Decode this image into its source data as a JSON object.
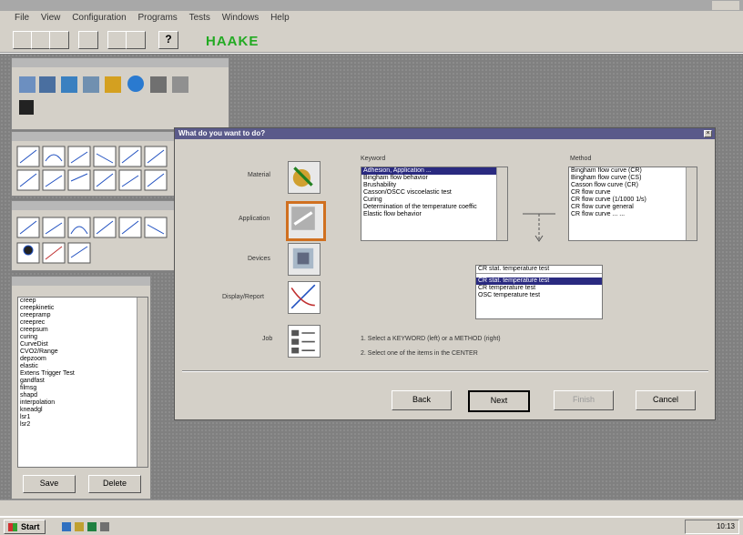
{
  "app": {
    "brand": "HAAKE",
    "brand_color": "#22aa22"
  },
  "menu": [
    "File",
    "View",
    "Configuration",
    "Programs",
    "Tests",
    "Windows",
    "Help"
  ],
  "dialog": {
    "title": "What do you want to do?",
    "categories": [
      "Material",
      "Application",
      "Devices",
      "Display/Report",
      "Job"
    ],
    "keyword_label": "Keyword",
    "method_label": "Method",
    "keywords": [
      "Adhesion, Application ...",
      "Bingham flow behavior",
      "Brushability",
      "Casson/OSCC viscoelastic test",
      "Curing",
      "Determination of the temperature coeffic",
      "Elastic flow behavior"
    ],
    "methods": [
      "Bingham flow curve (CR)",
      "Bingham flow curve (CS)",
      "Casson flow curve (CR)",
      "CR flow curve",
      "CR flow curve (1/1000 1/s)",
      "CR flow curve general",
      "CR flow curve ... ..."
    ],
    "center_title": "CR stat. temperature test",
    "center_items": [
      "CR stat. temperature test",
      "CR temperature test",
      "OSC temperature test"
    ],
    "instructions": [
      "1. Select a KEYWORD (left) or a METHOD (right)",
      "2. Select one of the items in the CENTER"
    ],
    "buttons": {
      "back": "Back",
      "next": "Next",
      "finish": "Finish",
      "cancel": "Cancel"
    }
  },
  "file_list": {
    "items": [
      "creep",
      "creepkinetic",
      "creepramp",
      "creeprec",
      "creepsum",
      "curing",
      "CurveDist",
      "CVO2/Range",
      "depzoom",
      "elastic",
      "Extens Trigger Test",
      "gandfast",
      "filmsg",
      "shapd",
      "interpolation",
      "kneadgl",
      "lsr1",
      "lsr2"
    ],
    "save_label": "Save",
    "delete_label": "Delete"
  },
  "taskbar": {
    "start_label": "Start",
    "clock": "10:13"
  }
}
